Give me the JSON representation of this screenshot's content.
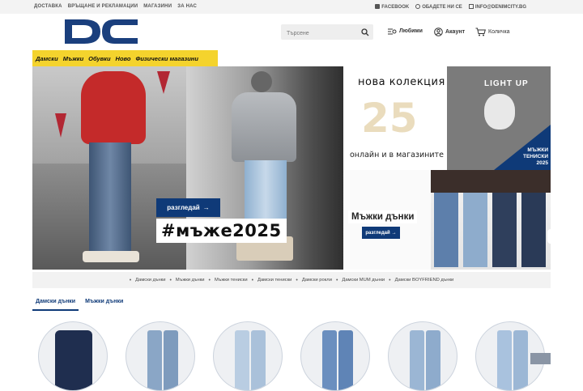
{
  "topbar": {
    "links": [
      "ДОСТАВКА",
      "ВРЪЩАНЕ И РЕКЛАМАЦИИ",
      "МАГАЗИНИ",
      "ЗА НАС"
    ],
    "facebook": "FACEBOOK",
    "call": "ОБАДЕТЕ НИ СЕ",
    "email": "INFO@DENIMCITY.BG"
  },
  "header": {
    "logo_text": "DC",
    "search_placeholder": "Търсене",
    "favorites": "Любими",
    "account": "Акаунт",
    "cart": "Количка"
  },
  "nav": [
    "Дамски",
    "Мъжки",
    "Обувки",
    "Ново",
    "Физически магазини"
  ],
  "hero": {
    "headline": "#мъже2025",
    "cta": "разгледай"
  },
  "promo_top": {
    "title": "нова колекция",
    "number": "25",
    "subtitle": "онлайн и в магазините",
    "shirt_text": "LIGHT UP",
    "corner_text": [
      "МЪЖКИ",
      "ТЕНИСКИ",
      "2025"
    ]
  },
  "promo_bottom": {
    "label": "Мъжки дънки",
    "cta": "разгледай"
  },
  "categories": [
    "Дамски дънки",
    "Мъжки дънки",
    "Мъжки тениски",
    "Дамски тениски",
    "Дамски рокли",
    "Дамски MUM дънки",
    "Дамски BOYFRIEND дънки"
  ],
  "tabs": [
    "Дамски дънки",
    "Мъжки дънки"
  ],
  "colors": {
    "brand_blue": "#0f3a78",
    "nav_yellow": "#f4d32d"
  }
}
